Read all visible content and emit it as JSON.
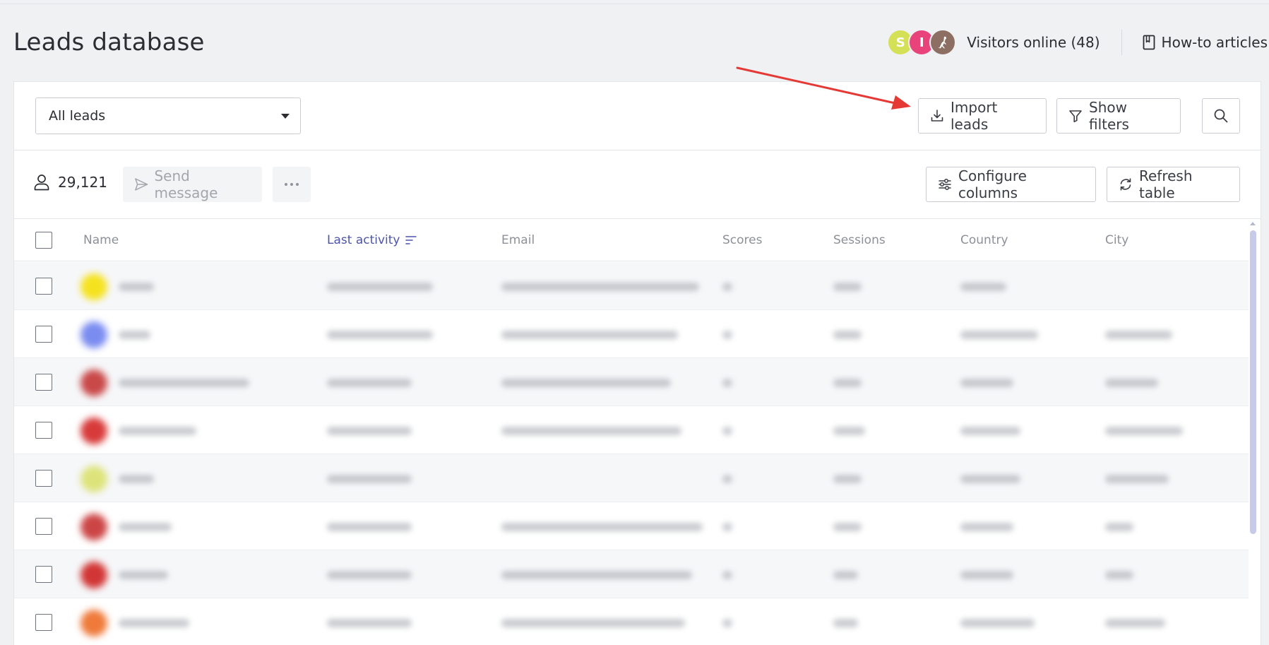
{
  "page": {
    "title": "Leads database"
  },
  "header": {
    "avatars": [
      {
        "initial": "S",
        "color": "#d4e157"
      },
      {
        "initial": "I",
        "color": "#e8437a"
      },
      {
        "initial": "",
        "icon": "kangaroo-icon",
        "color": "#8d6e63"
      }
    ],
    "visitors_label": "Visitors online (48)",
    "howto_label": "How-to articles"
  },
  "toolbar": {
    "segment_select": "All leads",
    "import_label": "Import leads",
    "filters_label": "Show filters"
  },
  "actions": {
    "lead_count": "29,121",
    "send_label": "Send message",
    "configure_label": "Configure columns",
    "refresh_label": "Refresh table"
  },
  "table": {
    "columns": [
      "Name",
      "Last activity",
      "Email",
      "Scores",
      "Sessions",
      "Country",
      "City"
    ],
    "sorted_column": "Last activity",
    "rows": [
      {
        "avatar_color": "#f5e21f"
      },
      {
        "avatar_color": "#7a8cf0"
      },
      {
        "avatar_color": "#c94848"
      },
      {
        "avatar_color": "#d83a3a"
      },
      {
        "avatar_color": "#dde37a"
      },
      {
        "avatar_color": "#cc4545"
      },
      {
        "avatar_color": "#d23535"
      },
      {
        "avatar_color": "#ef7a3a"
      }
    ]
  },
  "colors": {
    "accent": "#4d55a8",
    "arrow": "#e53935",
    "background": "#f0f1f3"
  }
}
